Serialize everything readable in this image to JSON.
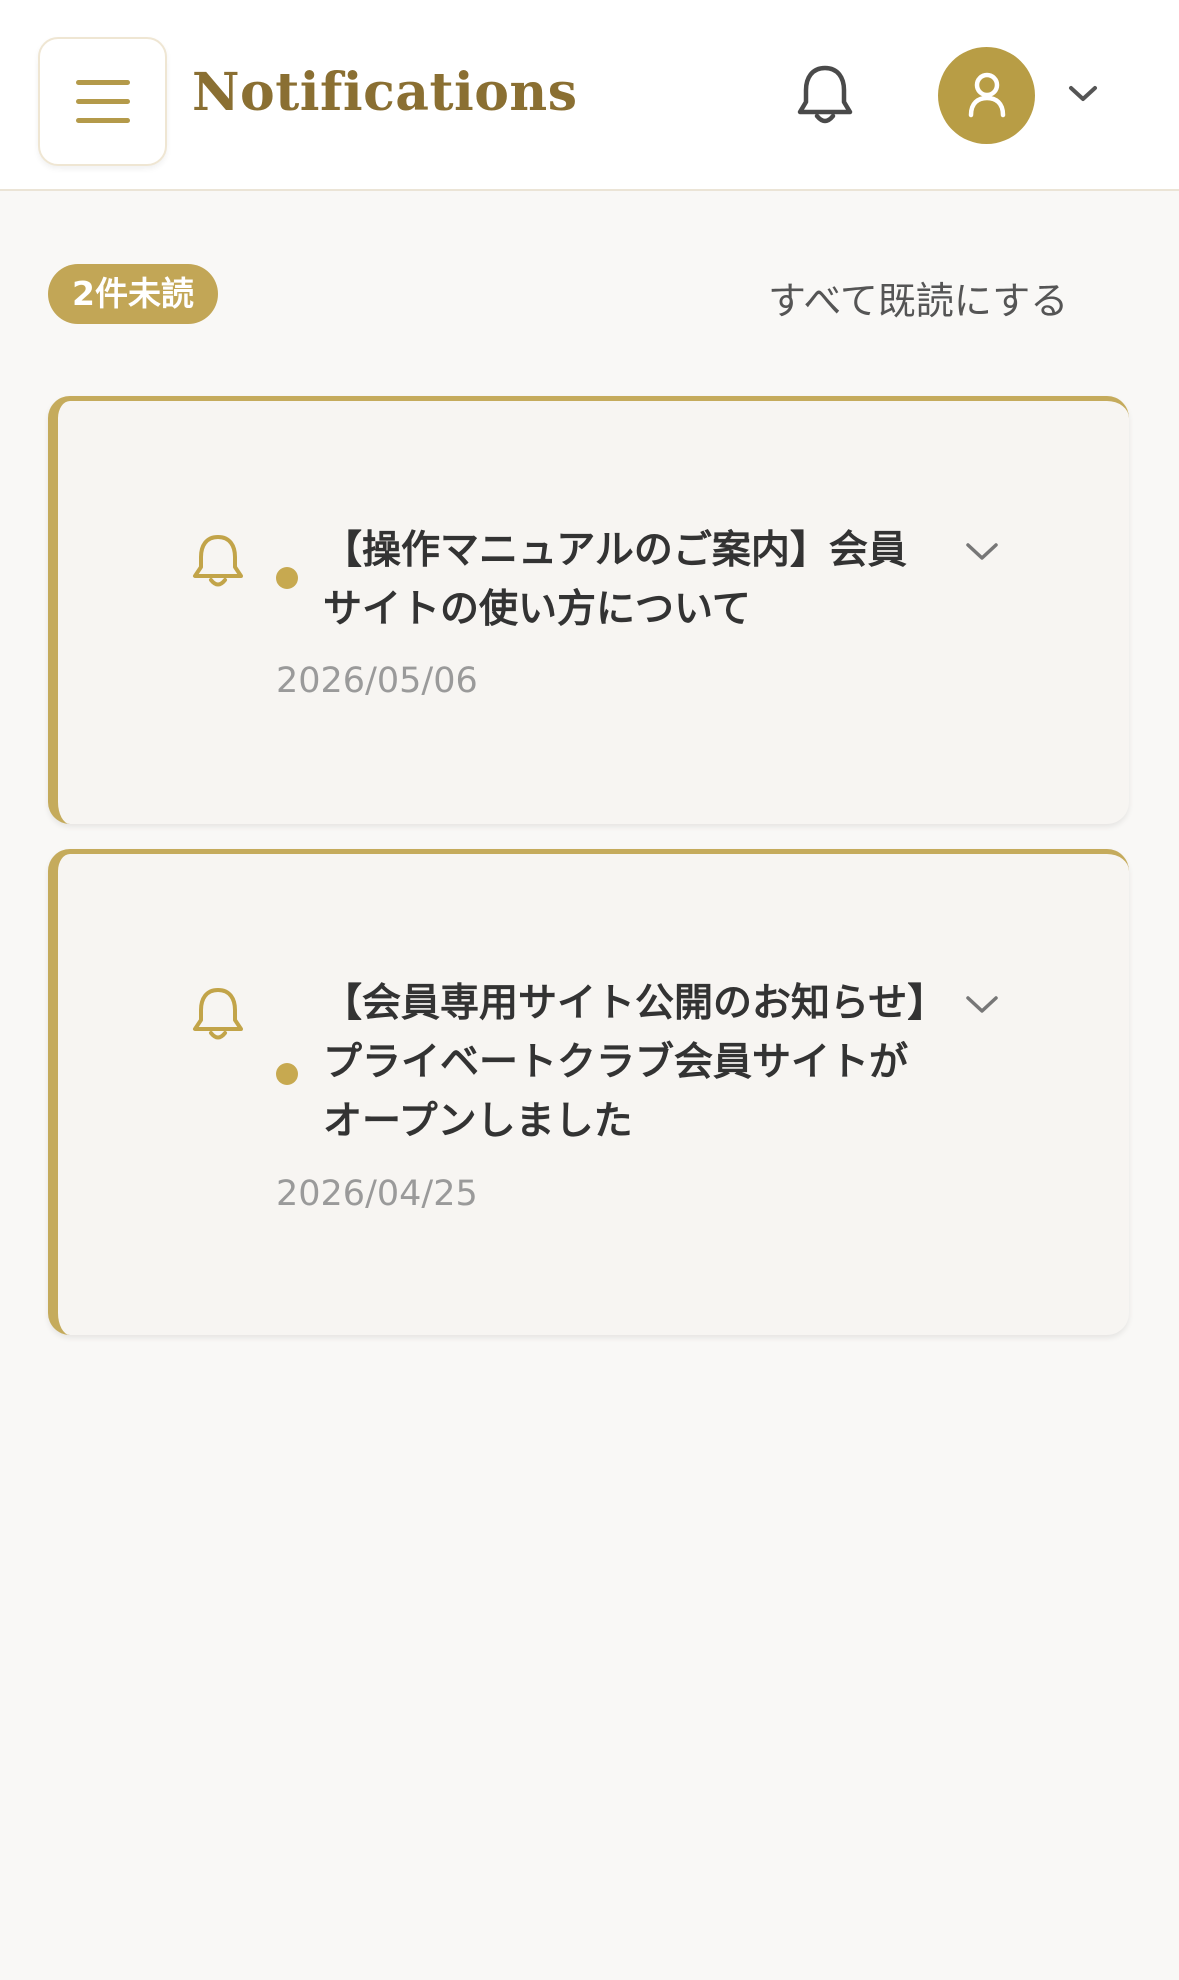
{
  "header": {
    "title": "Notifications",
    "menu_icon": "hamburger-menu-icon",
    "bell_icon": "bell-icon",
    "avatar_icon": "user-icon",
    "dropdown_icon": "chevron-down-icon"
  },
  "toolbar": {
    "unread_badge": "2件未読",
    "mark_all_read": "すべて既読にする"
  },
  "notifications": [
    {
      "title": "【操作マニュアルのご案内】会員サイトの使い方について",
      "date": "2026/05/06",
      "unread": true
    },
    {
      "title": "【会員専用サイト公開のお知らせ】プライベートクラブ会員サイトがオープンしました",
      "date": "2026/04/25",
      "unread": true
    }
  ],
  "colors": {
    "accent": "#c5ab5c",
    "title_brown": "#8a6f32",
    "background": "#f9f8f6"
  }
}
